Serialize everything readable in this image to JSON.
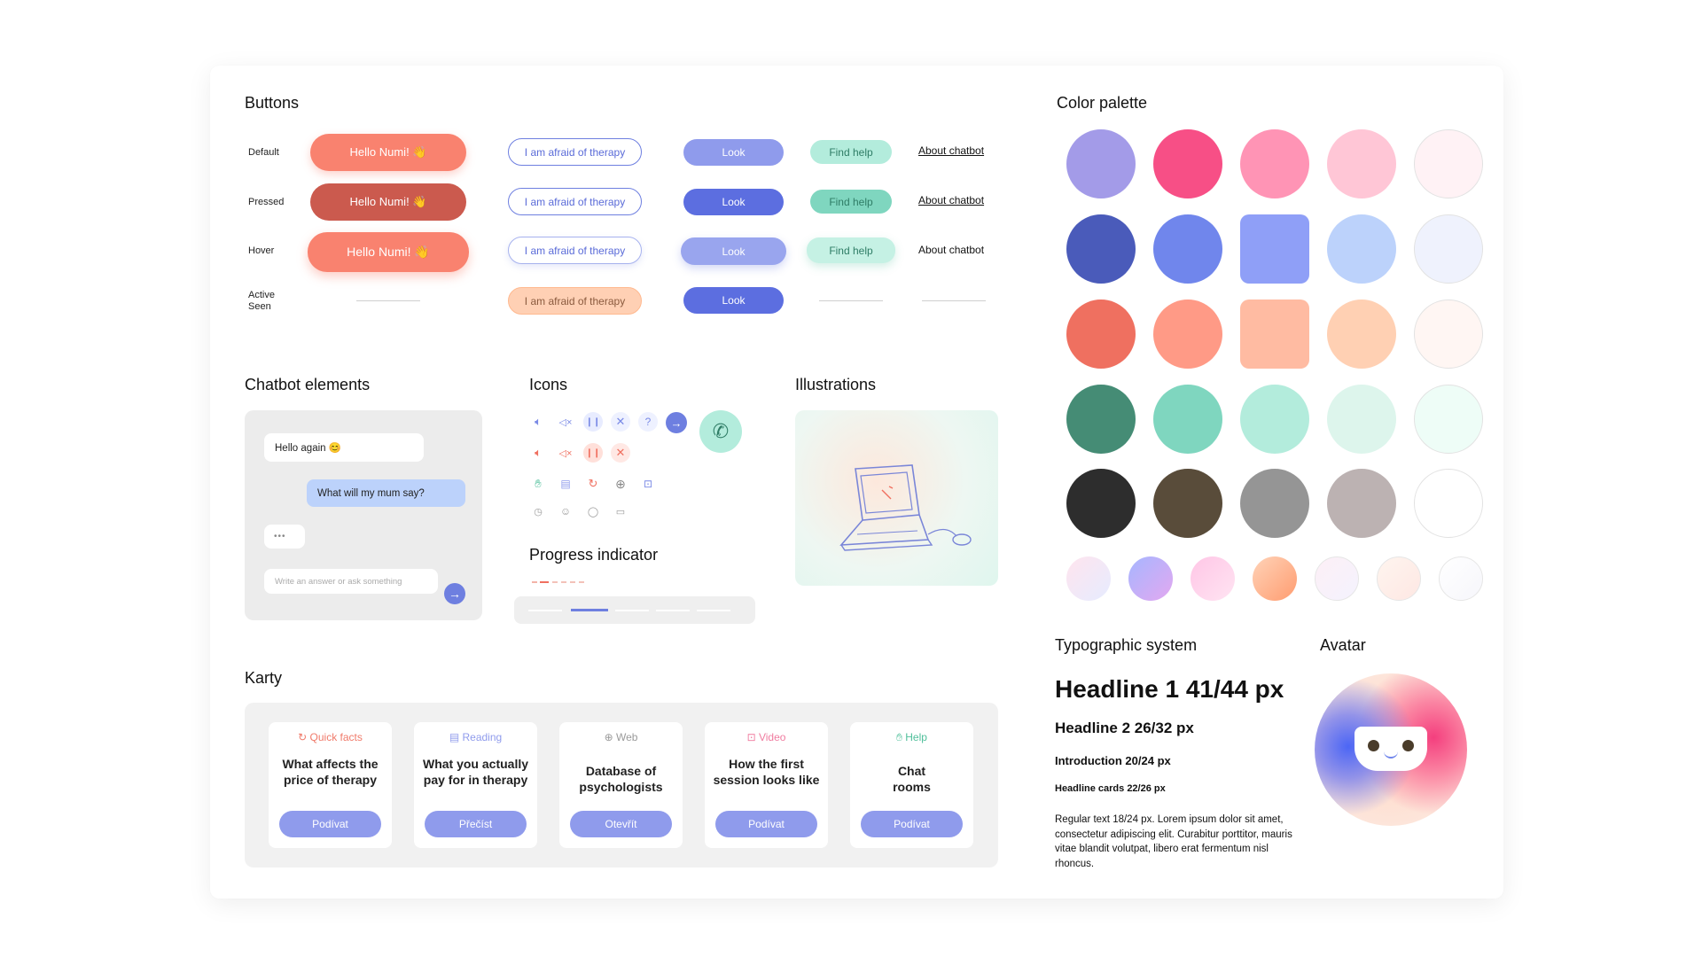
{
  "buttons": {
    "title": "Buttons",
    "states": [
      "Default",
      "Pressed",
      "Hover",
      "Active\nSeen"
    ],
    "primary_label": "Hello Numi! 👋",
    "outline_label": "I am afraid of therapy",
    "blue_label": "Look",
    "mint_label": "Find help",
    "link_label": "About chatbot"
  },
  "chatbot": {
    "title": "Chatbot elements",
    "bubble_bot": "Hello again 😊",
    "bubble_user": "What will my mum say?",
    "typing": "•••",
    "input_placeholder": "Write an answer or ask something",
    "send_icon": "arrow-right-icon"
  },
  "icons": {
    "title": "Icons",
    "row1": [
      "speaker-icon",
      "mute-icon",
      "pause-icon",
      "close-icon",
      "help-icon",
      "next-icon"
    ],
    "row2": [
      "speaker-icon",
      "mute-icon",
      "pause-icon",
      "close-icon"
    ],
    "row3": [
      "hand-icon",
      "document-icon",
      "refresh-icon",
      "globe-icon",
      "video-icon"
    ],
    "row4": [
      "clock-icon",
      "smile-icon",
      "chat-icon",
      "calendar-icon"
    ],
    "call_icon": "phone-icon"
  },
  "illustrations": {
    "title": "Illustrations"
  },
  "progress": {
    "title": "Progress indicator"
  },
  "cards": {
    "title": "Karty",
    "items": [
      {
        "tag": "Quick facts",
        "title": "What affects the price of therapy",
        "button": "Podívat",
        "color": "#f07a6a",
        "icon": "refresh-icon"
      },
      {
        "tag": "Reading",
        "title": "What you actually pay for in therapy",
        "button": "Přečíst",
        "color": "#8f9bec",
        "icon": "document-icon"
      },
      {
        "tag": "Web",
        "title": "Database of psychologists",
        "button": "Otevřít",
        "color": "#9a9a9a",
        "icon": "globe-icon"
      },
      {
        "tag": "Video",
        "title": "How the first session looks like",
        "button": "Podívat",
        "color": "#f07ca0",
        "icon": "video-icon"
      },
      {
        "tag": "Help",
        "title": "Chat rooms",
        "button": "Podívat",
        "color": "#4fbf9a",
        "icon": "hand-icon"
      }
    ]
  },
  "palette": {
    "title": "Color palette",
    "rows": [
      [
        "#a39be8",
        "#f74f86",
        "#ff94b5",
        "#ffc6d6",
        "#fff2f5"
      ],
      [
        "#4a5bba",
        "#7086ec",
        "#8f9ff7",
        "#bcd2fb",
        "#eff2fd"
      ],
      [
        "#ef7060",
        "#ff9a86",
        "#ffbba2",
        "#ffd0b3",
        "#fff6f3"
      ],
      [
        "#458c75",
        "#7fd6bf",
        "#b3ecdc",
        "#ddf5ec",
        "#eefdf7"
      ],
      [
        "#2d2d2d",
        "#594c3a",
        "#959595",
        "#bcb2b2",
        "#ffffff"
      ]
    ],
    "gradients": [
      [
        "#ffe4ee",
        "#e6ecff"
      ],
      [
        "#a6b6ff",
        "#e3a8f0"
      ],
      [
        "#ffc6e6",
        "#ffe4f2"
      ],
      [
        "#ffd3b8",
        "#ff9c70"
      ],
      [
        "#fdf0f6",
        "#f4f2fe"
      ],
      [
        "#fff5ef",
        "#fde7e3"
      ],
      [
        "#ffffff",
        "#f6f6fb"
      ]
    ]
  },
  "typography": {
    "title": "Typographic system",
    "h1": "Headline 1 41/44 px",
    "h2": "Headline 2 26/32 px",
    "intro": "Introduction 20/24 px",
    "cards": "Headline cards 22/26 px",
    "regular": "Regular text 18/24 px. Lorem ipsum dolor sit amet, consectetur adipiscing elit. Curabitur porttitor, mauris vitae blandit volutpat, libero erat fermentum nisl rhoncus."
  },
  "avatar": {
    "title": "Avatar"
  }
}
